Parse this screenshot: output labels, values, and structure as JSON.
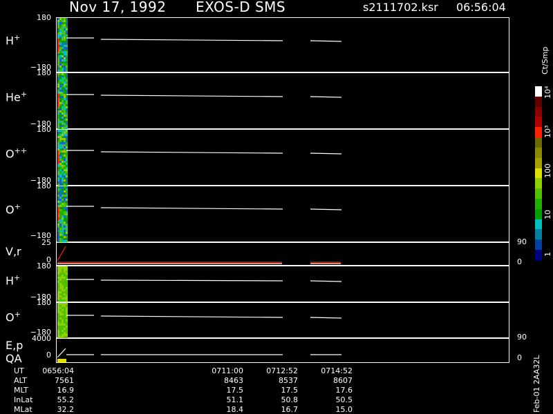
{
  "header": {
    "date": "Nov 17, 1992",
    "instrument": "EXOS-D SMS",
    "filename": "s2111702.ksr",
    "time": "06:56:04"
  },
  "panels": [
    {
      "label": "H",
      "sup": "+",
      "ymax": "180",
      "ymin": "−180"
    },
    {
      "label": "He",
      "sup": "+",
      "ymax": "180",
      "ymin": "−180"
    },
    {
      "label": "O",
      "sup": "++",
      "ymax": "180",
      "ymin": "−180"
    },
    {
      "label": "O",
      "sup": "+",
      "ymax": "180",
      "ymin": "−180"
    },
    {
      "label": "V,r",
      "sup": "",
      "ymax": "25",
      "ymin": "0",
      "rmax": "90",
      "rmin": "0"
    },
    {
      "label": "H",
      "sup": "+",
      "ymax": "180",
      "ymin": "−180"
    },
    {
      "label": "O",
      "sup": "+",
      "ymax": "180",
      "ymin": "−180"
    },
    {
      "label": "E,p",
      "sup": "",
      "ymax": "4000",
      "ymin": "0",
      "rmax": "90",
      "rmin": "0",
      "label2": "QA"
    }
  ],
  "colorbar": {
    "unit": "Ct/Smp",
    "ticks": [
      "1",
      "10",
      "100",
      "10³",
      "10⁴"
    ],
    "colors": [
      "#ffffff",
      "#600000",
      "#8a0000",
      "#b00000",
      "#ff2000",
      "#6a6a00",
      "#8a8a00",
      "#a8a000",
      "#e0e000",
      "#90d000",
      "#50c000",
      "#20b000",
      "#00a000",
      "#00c0c0",
      "#0080a0",
      "#0040a0",
      "#000080"
    ]
  },
  "chart_data": {
    "type": "line",
    "title": "Nov 17, 1992   EXOS-D SMS",
    "x_axis_times": [
      "0656:04",
      "0711:00",
      "0712:52",
      "0714:52"
    ]
  },
  "footer": {
    "labels": [
      "UT",
      "ALT",
      "MLT",
      "InLat",
      "MLat"
    ],
    "columns": [
      [
        "0656:04",
        "7561",
        "16.9",
        "55.2",
        "32.2"
      ],
      [
        "0711:00",
        "8463",
        "17.5",
        "51.1",
        "18.4"
      ],
      [
        "0712:52",
        "8537",
        "17.5",
        "50.8",
        "16.7"
      ],
      [
        "0714:52",
        "8607",
        "17.6",
        "50.5",
        "15.0"
      ]
    ],
    "stamp": "Feb-01 2AA32L"
  }
}
